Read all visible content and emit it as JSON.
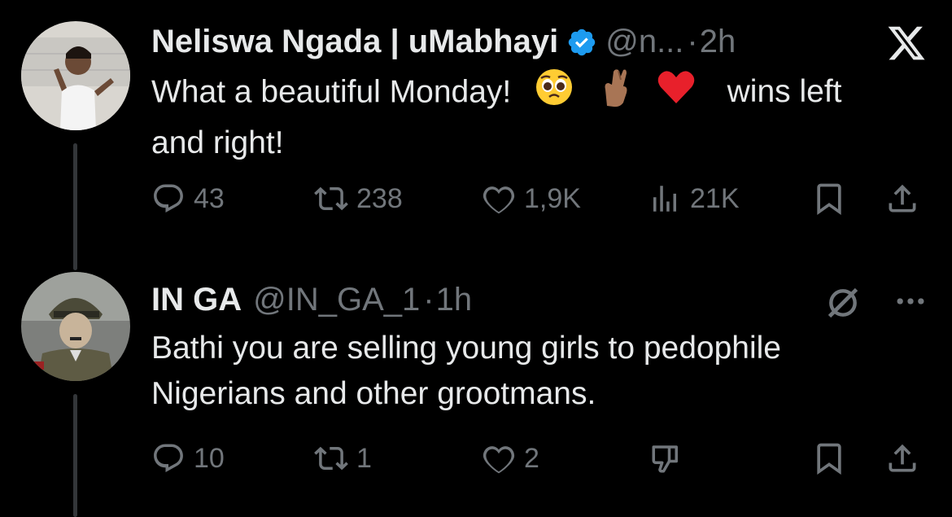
{
  "tweets": [
    {
      "display_name": "Neliswa Ngada | uMabhayi",
      "handle": "@n...",
      "dot": "·",
      "time": "2h",
      "text_line1_a": "What a beautiful Monday!",
      "text_line1_b": "wins left",
      "text_line2": "and right!",
      "emojis": [
        "pleading-face-emoji",
        "crossed-fingers-emoji",
        "red-heart-emoji"
      ],
      "replies": "43",
      "retweets": "238",
      "likes": "1,9K",
      "views": "21K"
    },
    {
      "display_name": "IN GA",
      "handle": "@IN_GA_1",
      "dot": "·",
      "time": "1h",
      "text_line1": "Bathi you are selling young girls to pedophile",
      "text_line2": "Nigerians and other grootmans.",
      "replies": "10",
      "retweets": "1",
      "likes": "2"
    }
  ],
  "colors": {
    "background": "#000000",
    "text": "#e7e9ea",
    "muted": "#71767b",
    "verified": "#1d9bf0",
    "thread_line": "#333639"
  }
}
